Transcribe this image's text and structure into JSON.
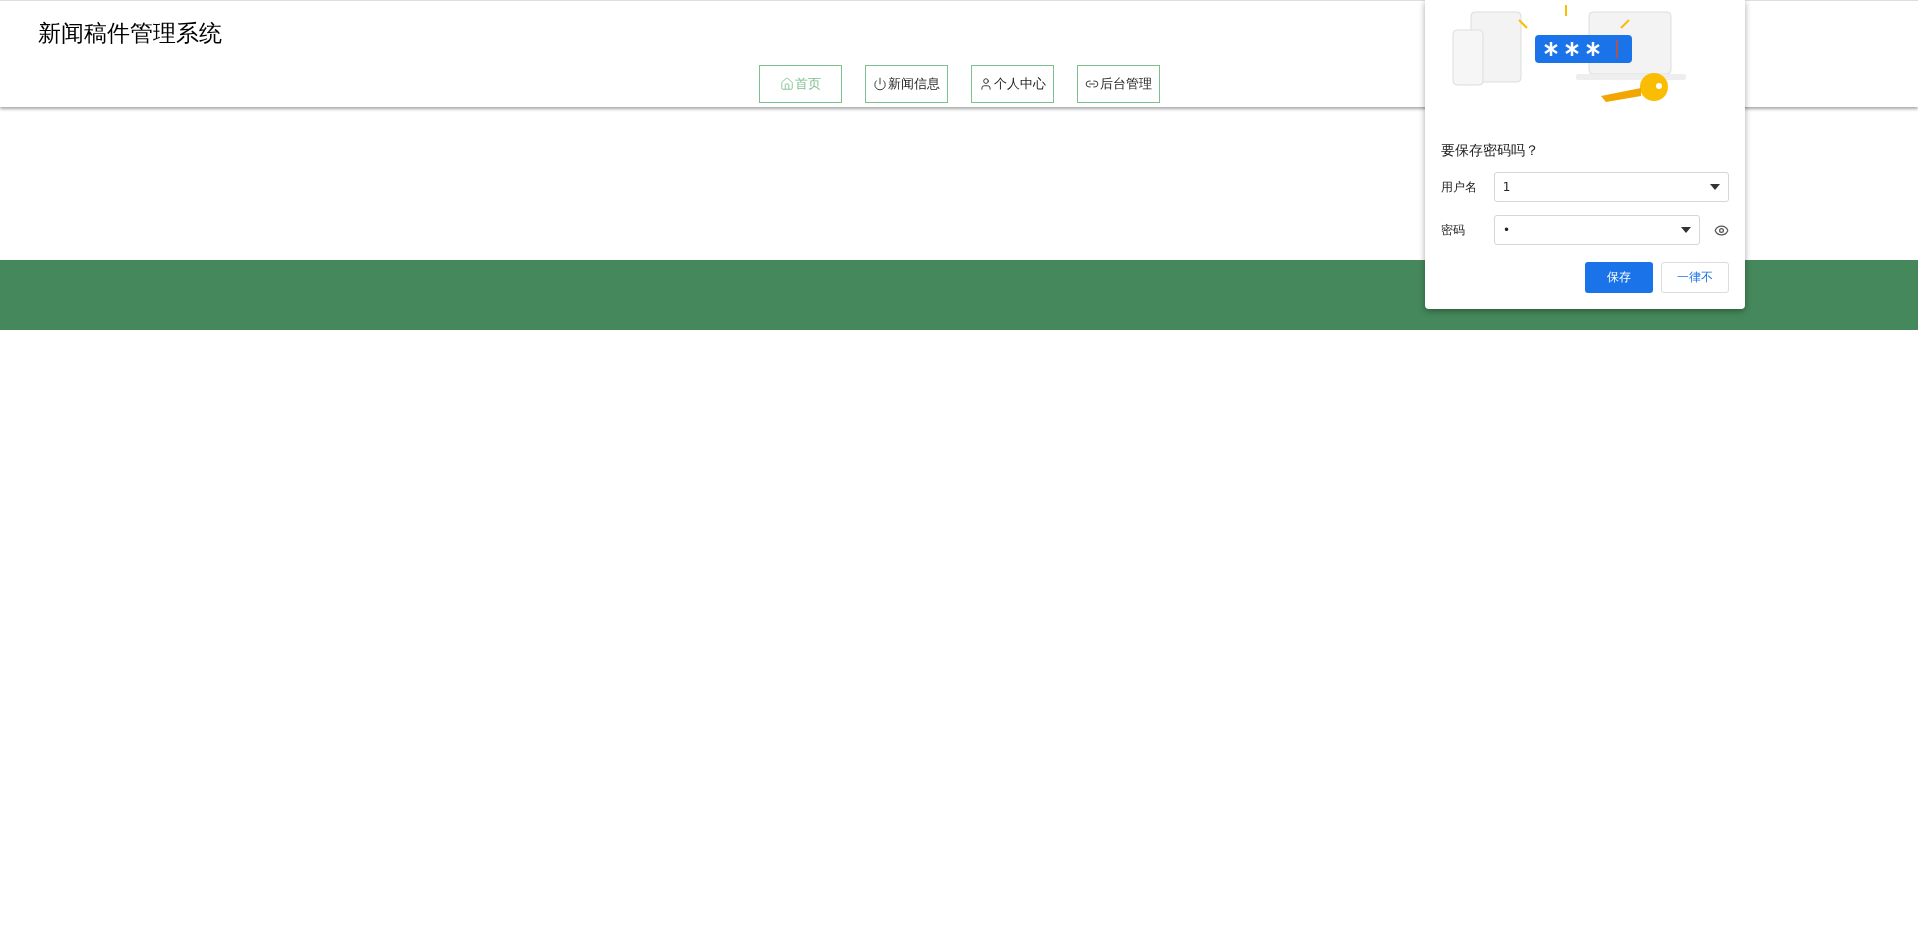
{
  "header": {
    "title": "新闻稿件管理系统"
  },
  "nav": [
    {
      "label": "首页",
      "kind": "home",
      "selected": true
    },
    {
      "label": "新闻信息",
      "kind": "power",
      "selected": false
    },
    {
      "label": "个人中心",
      "kind": "user",
      "selected": false
    },
    {
      "label": "后台管理",
      "kind": "link",
      "selected": false
    }
  ],
  "save_password_popup": {
    "title": "要保存密码吗？",
    "username_label": "用户名",
    "username_value": "1",
    "password_label": "密码",
    "password_value": "•",
    "save_button": "保存",
    "never_button": "一律不"
  }
}
